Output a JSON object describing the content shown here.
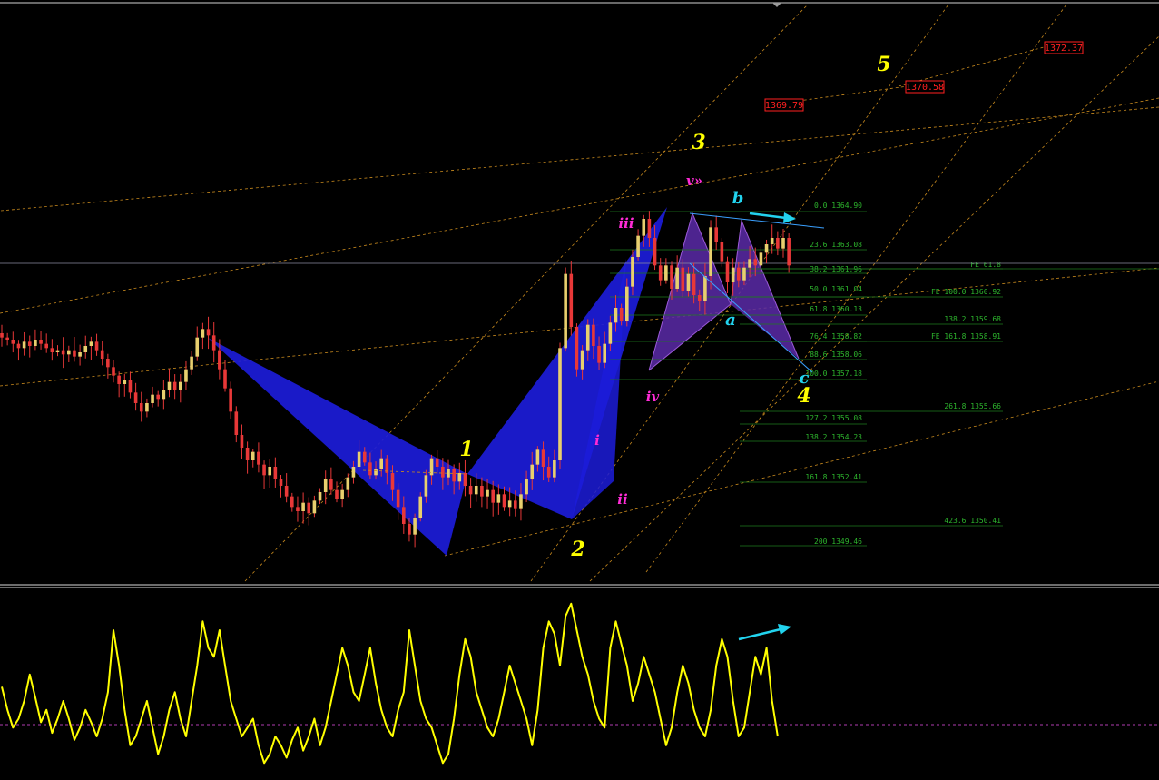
{
  "colors": {
    "background": "#000000",
    "candle": "#e8cf6e",
    "candle_wick": "#e83838",
    "harmonic_blue": "#1c1cd9",
    "harmonic_purple": "#5a2aa8",
    "oscillator": "#ffff00",
    "fib_line": "#1e7a1e",
    "fib_text": "#2db52d",
    "channel": "#c88a1e",
    "wave_major": "#ffff00",
    "wave_minor": "#ff2bd6",
    "wave_abc": "#22d3ee",
    "price_tag": "#ff2020"
  },
  "wave_labels": {
    "major": [
      "1",
      "2",
      "3",
      "4",
      "5"
    ],
    "minor": [
      "i",
      "ii",
      "iii",
      "iv",
      "v»"
    ],
    "corrective": [
      "a",
      "b",
      "c"
    ]
  },
  "price_tags": [
    "1372.37",
    "1370.58",
    "1369.79"
  ],
  "fib_retracement": [
    "0.0 1364.90",
    "23.6 1363.08",
    "38.2 1361.96",
    "50.0 1361.04",
    "61.8 1360.13",
    "76.4 1358.82",
    "88.6 1358.06",
    "100.0 1357.18",
    "127.2 1355.08",
    "138.2 1354.23",
    "161.8 1352.41",
    "200 1349.46"
  ],
  "fib_expansion": [
    "FE 61.8",
    "FE 100.0 1360.92",
    "138.2 1359.68",
    "FE 161.8 1358.91",
    "261.8 1355.66",
    "423.6 1350.41"
  ],
  "chart_data": {
    "type": "line",
    "title": "",
    "xlabel": "",
    "ylabel": "",
    "ylim": [
      1347.5,
      1374.5
    ],
    "grid": false,
    "legend": "none",
    "series": [
      {
        "name": "",
        "type": "candlestick-close",
        "values": [
          1359.0,
          1358.9,
          1358.7,
          1358.5,
          1358.8,
          1358.6,
          1358.9,
          1358.7,
          1358.5,
          1358.3,
          1358.4,
          1358.2,
          1358.4,
          1358.1,
          1358.3,
          1358.6,
          1358.8,
          1358.4,
          1358.0,
          1357.6,
          1357.2,
          1356.8,
          1357.0,
          1356.4,
          1355.9,
          1355.5,
          1355.9,
          1356.3,
          1356.1,
          1356.5,
          1356.9,
          1356.5,
          1356.9,
          1357.5,
          1358.1,
          1359.0,
          1359.4,
          1359.1,
          1358.4,
          1357.5,
          1356.6,
          1355.5,
          1354.4,
          1353.8,
          1353.2,
          1353.6,
          1353.0,
          1352.5,
          1352.9,
          1352.3,
          1352.0,
          1351.5,
          1351.0,
          1350.8,
          1351.2,
          1350.7,
          1351.3,
          1351.7,
          1352.3,
          1351.8,
          1351.4,
          1351.8,
          1352.4,
          1352.9,
          1353.6,
          1353.1,
          1352.5,
          1352.8,
          1353.3,
          1352.6,
          1351.8,
          1351.0,
          1350.2,
          1349.7,
          1350.5,
          1351.5,
          1352.5,
          1353.3,
          1352.9,
          1352.4,
          1352.8,
          1352.2,
          1352.6,
          1352.0,
          1351.6,
          1352.0,
          1351.5,
          1351.8,
          1351.2,
          1351.6,
          1351.0,
          1351.3,
          1350.9,
          1351.6,
          1352.3,
          1353.0,
          1353.7,
          1352.9,
          1352.4,
          1353.2,
          1358.5,
          1362.0,
          1359.5,
          1357.5,
          1358.4,
          1359.6,
          1358.6,
          1357.8,
          1358.7,
          1359.7,
          1360.4,
          1359.8,
          1361.4,
          1362.8,
          1363.8,
          1364.6,
          1363.7,
          1362.4,
          1361.7,
          1362.4,
          1361.3,
          1362.3,
          1361.2,
          1362.0,
          1361.0,
          1360.7,
          1361.9,
          1364.2,
          1363.5,
          1362.6,
          1361.6,
          1362.3,
          1361.7,
          1362.3,
          1362.7,
          1362.4,
          1363.0,
          1363.4,
          1363.7,
          1363.2,
          1363.7,
          1362.4
        ]
      },
      {
        "name": "",
        "type": "oscillator",
        "values": [
          48,
          35,
          25,
          30,
          40,
          55,
          42,
          28,
          35,
          22,
          30,
          40,
          30,
          18,
          25,
          35,
          28,
          20,
          30,
          45,
          80,
          60,
          35,
          15,
          20,
          30,
          40,
          25,
          10,
          20,
          35,
          45,
          30,
          20,
          40,
          60,
          85,
          70,
          65,
          80,
          60,
          40,
          30,
          20,
          25,
          30,
          15,
          5,
          10,
          20,
          15,
          8,
          18,
          25,
          12,
          20,
          30,
          15,
          25,
          40,
          55,
          70,
          60,
          45,
          40,
          55,
          70,
          50,
          35,
          25,
          20,
          35,
          45,
          80,
          60,
          40,
          30,
          25,
          15,
          5,
          10,
          30,
          55,
          75,
          65,
          45,
          35,
          25,
          20,
          30,
          45,
          60,
          50,
          40,
          30,
          15,
          35,
          70,
          85,
          78,
          60,
          88,
          95,
          80,
          65,
          55,
          40,
          30,
          25,
          70,
          85,
          72,
          60,
          40,
          50,
          65,
          55,
          45,
          30,
          15,
          25,
          45,
          60,
          50,
          35,
          25,
          20,
          35,
          60,
          75,
          65,
          40,
          20,
          25,
          45,
          65,
          55,
          70,
          40,
          20
        ]
      }
    ]
  }
}
